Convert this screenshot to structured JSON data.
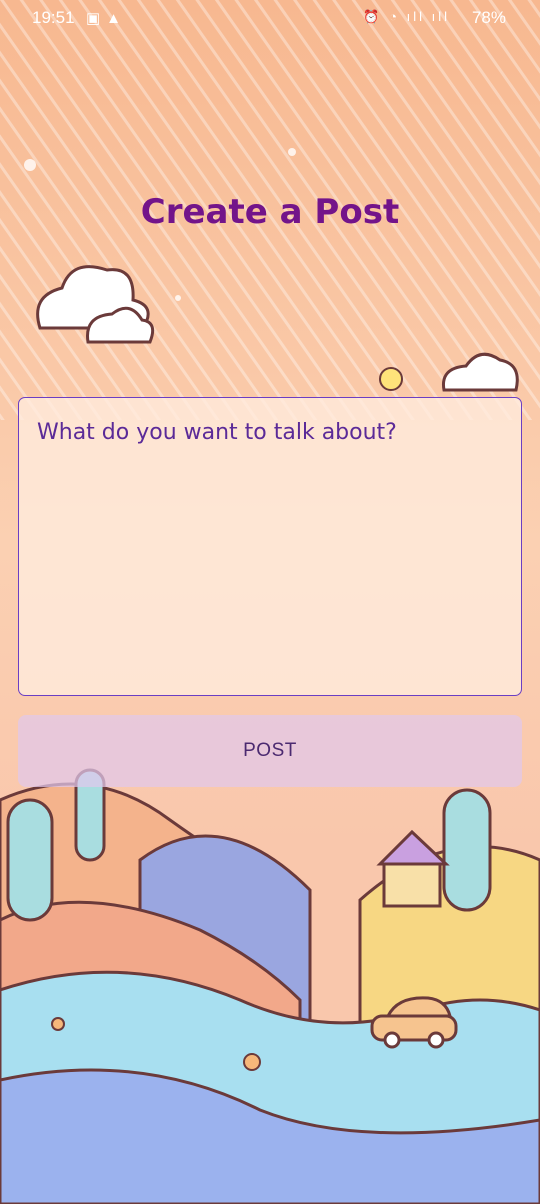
{
  "status_bar": {
    "time": "19:51",
    "battery": "78%"
  },
  "page": {
    "title": "Create a Post"
  },
  "composer": {
    "placeholder": "What do you want to talk about?",
    "value": ""
  },
  "actions": {
    "post_label": "POST"
  },
  "colors": {
    "title": "#73148a",
    "field_border": "#6a3ec4",
    "button_bg": "#e1c8eb"
  }
}
